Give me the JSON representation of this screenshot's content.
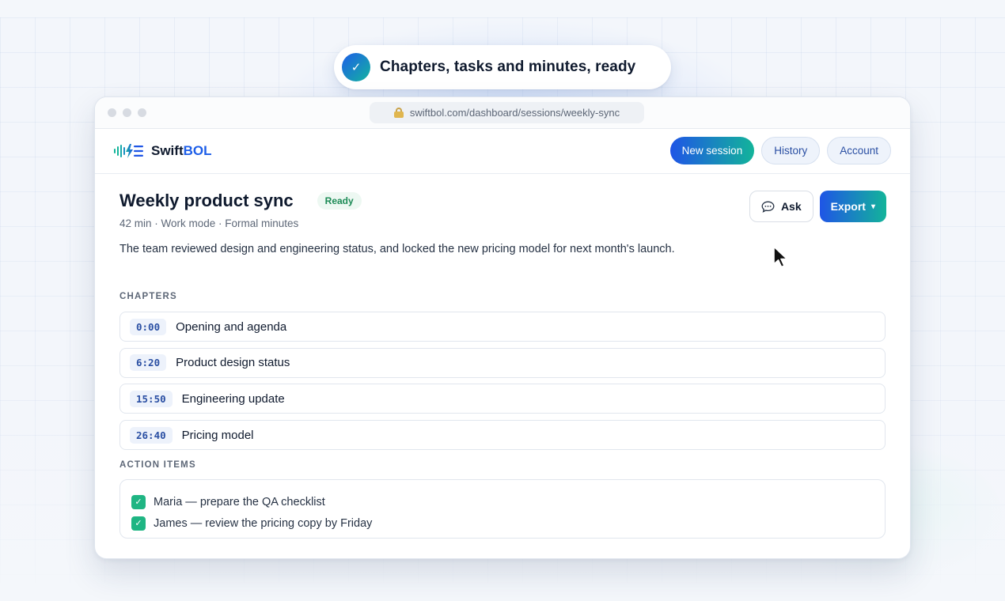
{
  "toast": {
    "text": "Chapters, tasks and minutes, ready",
    "icon": "check-icon"
  },
  "browser": {
    "url": "swiftbol.com/dashboard/sessions/weekly-sync"
  },
  "brand": {
    "name_prefix": "Swift",
    "name_accent": "BOL",
    "accent_color": "#1d5ee8"
  },
  "nav": {
    "new_session": "New session",
    "history": "History",
    "account": "Account"
  },
  "session": {
    "title": "Weekly product sync",
    "status": "Ready",
    "meta": "42 min · Work mode · Formal minutes",
    "summary": "The team reviewed design and engineering status, and locked the new pricing model for next month's launch.",
    "ask_label": "Ask",
    "export_label": "Export",
    "export_caret": "▾"
  },
  "chapters": {
    "label": "CHAPTERS",
    "items": [
      {
        "time": "0:00",
        "title": "Opening and agenda"
      },
      {
        "time": "6:20",
        "title": "Product design status"
      },
      {
        "time": "15:50",
        "title": "Engineering update"
      },
      {
        "time": "26:40",
        "title": "Pricing model"
      }
    ]
  },
  "action_items": {
    "label": "ACTION ITEMS",
    "items": [
      {
        "text": "Maria — prepare the QA checklist",
        "checked": true
      },
      {
        "text": "James — review the pricing copy by Friday",
        "checked": true
      }
    ]
  },
  "colors": {
    "primary_gradient_start": "#1f55e6",
    "primary_gradient_end": "#13b49a",
    "ready_badge": "#1b8a55",
    "checkbox": "#1fb583"
  }
}
